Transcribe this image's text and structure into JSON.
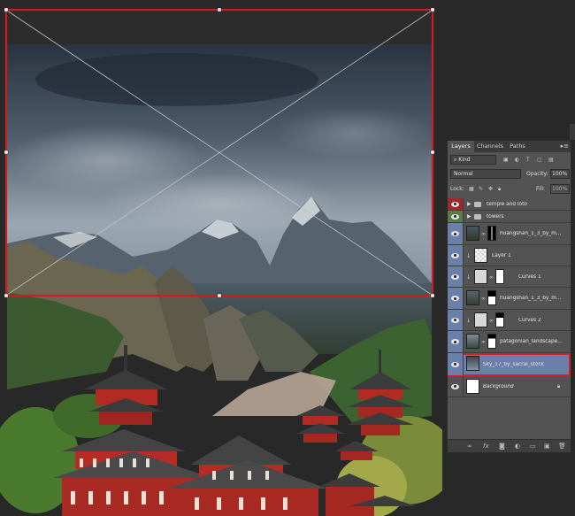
{
  "colors": {
    "selection_outline": "#cc1e22",
    "sky_dark": "#2c3744",
    "sky_light": "#9aa7b3",
    "temple_red": "#b22a22",
    "panel_bg": "#535353",
    "selected_layer_bg": "#6a7faa"
  },
  "layers_panel": {
    "tabs": [
      "Layers",
      "Channels",
      "Paths"
    ],
    "active_tab": "Layers",
    "menu_icon": "panel-menu-icon",
    "filter": {
      "value": "Kind",
      "icon": "search-icon"
    },
    "filter_tools": [
      "pixel-filter-icon",
      "adjustment-filter-icon",
      "type-filter-icon",
      "shape-filter-icon",
      "smart-object-filter-icon"
    ],
    "blend_mode": "Normal",
    "opacity_label": "Opacity:",
    "opacity_value": "100%",
    "lock_label": "Lock:",
    "fill_label": "Fill:",
    "fill_value": "100%",
    "layers": [
      {
        "name": "temple and loto",
        "type": "group",
        "eye_color": "#9b2b2b"
      },
      {
        "name": "towers",
        "type": "group",
        "eye_color": "#5c7a45"
      },
      {
        "name": "huangshan_1_3_by_m...",
        "type": "pixel-mask",
        "eye_color": "#6a7faa"
      },
      {
        "name": "Layer 1",
        "type": "pixel",
        "eye_color": "#6a7faa"
      },
      {
        "name": "Curves 1",
        "type": "adjustment",
        "eye_color": "#6a7faa"
      },
      {
        "name": "huangshan_1_3_by_m...",
        "type": "pixel-mask",
        "eye_color": "#6a7faa"
      },
      {
        "name": "Curves 2",
        "type": "adjustment",
        "eye_color": "#6a7faa"
      },
      {
        "name": "patagonian_landscape...",
        "type": "pixel-mask",
        "eye_color": "#6a7faa"
      },
      {
        "name": "Sky_17_by_sacral_stock",
        "type": "pixel",
        "eye_color": "#6a7faa",
        "selected": true
      },
      {
        "name": "Background",
        "type": "background",
        "eye_color": "#535353",
        "locked": true
      }
    ],
    "bottom_icons": [
      "link-layers-icon",
      "fx-icon",
      "add-mask-icon",
      "adjustment-layer-icon",
      "new-group-icon",
      "new-layer-icon",
      "delete-layer-icon"
    ]
  }
}
